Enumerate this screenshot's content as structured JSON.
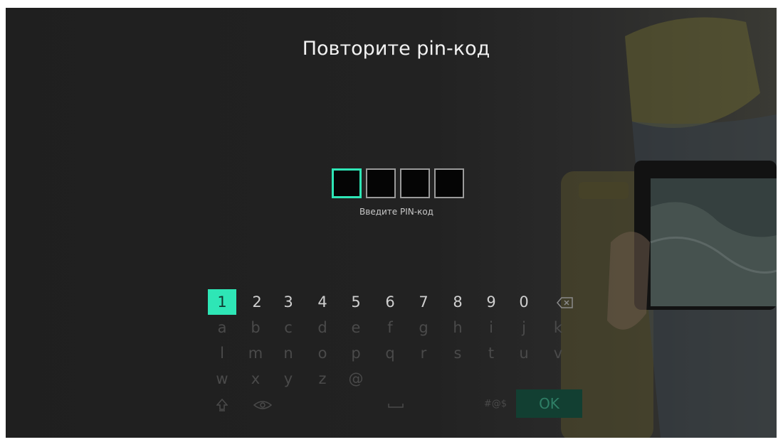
{
  "screen": {
    "title": "Повторите pin-код",
    "pin": {
      "length": 4,
      "active_index": 0,
      "hint": "Введите PIN-код"
    },
    "keyboard": {
      "digit_row": [
        "1",
        "2",
        "3",
        "4",
        "5",
        "6",
        "7",
        "8",
        "9",
        "0"
      ],
      "row2": [
        "a",
        "b",
        "c",
        "d",
        "e",
        "f",
        "g",
        "h",
        "i",
        "j",
        "k"
      ],
      "row3": [
        "l",
        "m",
        "n",
        "o",
        "p",
        "q",
        "r",
        "s",
        "t",
        "u",
        "v"
      ],
      "row4": [
        "w",
        "x",
        "y",
        "z",
        "@"
      ],
      "selected_key": "1",
      "backspace_icon": "backspace-icon",
      "shift_icon": "shift-icon",
      "show_password_icon": "eye-icon",
      "space_icon": "space-icon",
      "symbols_label": "#@$",
      "ok_label": "OK"
    },
    "colors": {
      "accent": "#2ee6b6",
      "background": "#222222",
      "ok_key_bg": "#123f32"
    }
  }
}
